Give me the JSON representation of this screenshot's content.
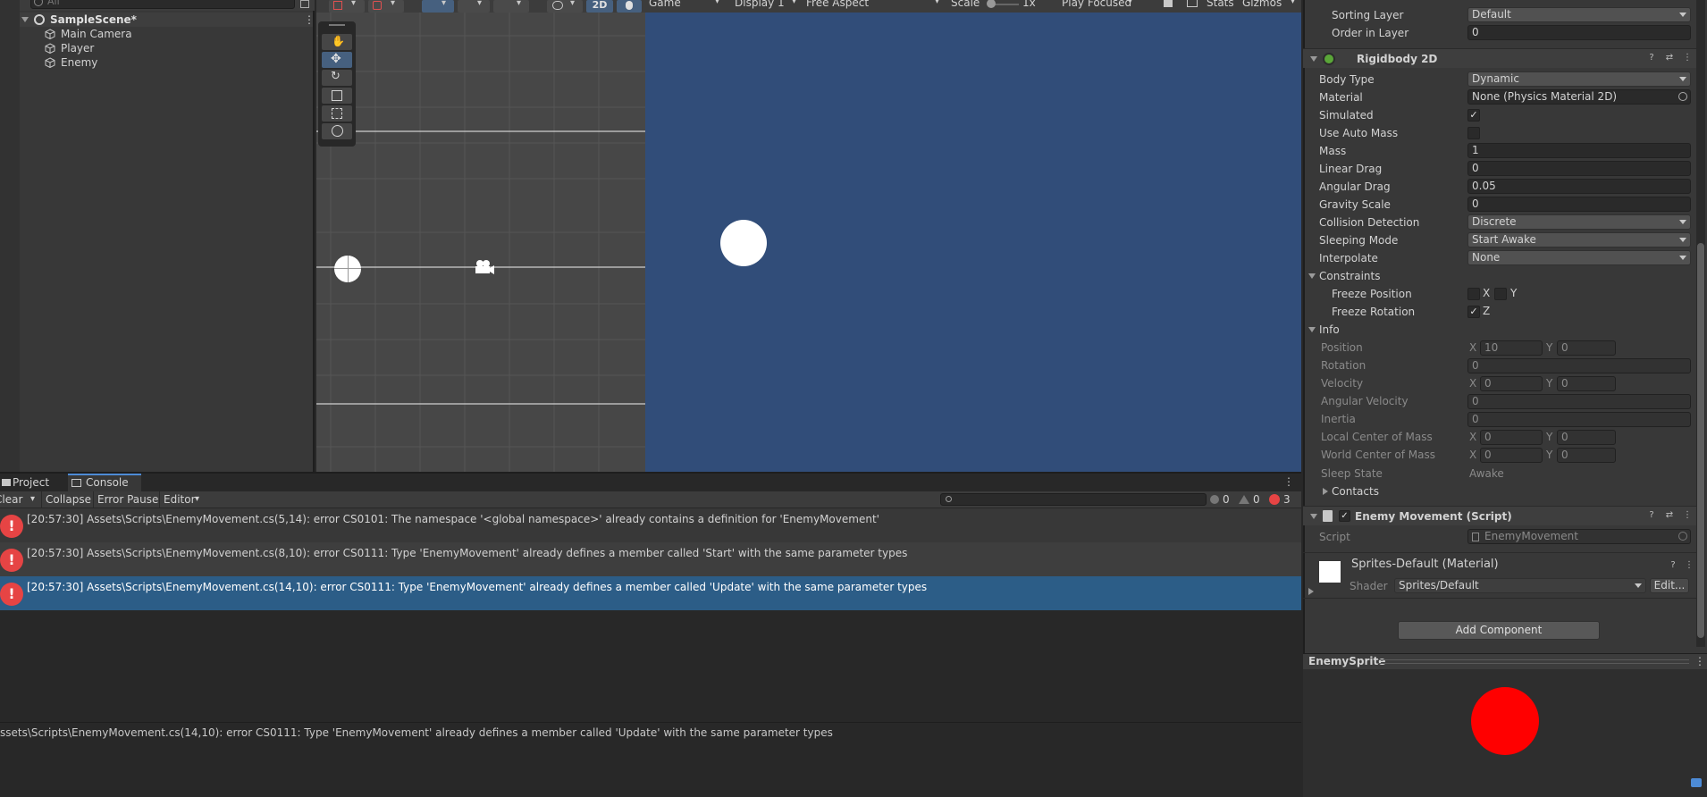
{
  "hierarchy": {
    "search_placeholder": "All",
    "scene_name": "SampleScene*",
    "items": [
      {
        "label": "Main Camera"
      },
      {
        "label": "Player"
      },
      {
        "label": "Enemy"
      }
    ]
  },
  "scene_toolbar": {
    "mode_2d": "2D"
  },
  "game_toolbar": {
    "view": "Game",
    "display": "Display 1",
    "aspect": "Free Aspect",
    "scale_label": "Scale",
    "scale_value": "1x",
    "play_mode": "Play Focused",
    "stats": "Stats",
    "gizmos": "Gizmos"
  },
  "console": {
    "tabs": [
      {
        "label": "Project"
      },
      {
        "label": "Console"
      }
    ],
    "toolbar": {
      "clear": "Clear",
      "collapse": "Collapse",
      "error_pause": "Error Pause",
      "editor": "Editor",
      "log_count": "0",
      "warn_count": "0",
      "error_count": "3"
    },
    "messages": [
      {
        "text": "[20:57:30] Assets\\Scripts\\EnemyMovement.cs(5,14): error CS0101: The namespace '<global namespace>' already contains a definition for 'EnemyMovement'"
      },
      {
        "text": "[20:57:30] Assets\\Scripts\\EnemyMovement.cs(8,10): error CS0111: Type 'EnemyMovement' already defines a member called 'Start' with the same parameter types"
      },
      {
        "text": "[20:57:30] Assets\\Scripts\\EnemyMovement.cs(14,10): error CS0111: Type 'EnemyMovement' already defines a member called 'Update' with the same parameter types"
      }
    ],
    "detail": "ssets\\Scripts\\EnemyMovement.cs(14,10): error CS0111: Type 'EnemyMovement' already defines a member called 'Update' with the same parameter types"
  },
  "inspector": {
    "sprite_renderer": {
      "sorting_layer_label": "Sorting Layer",
      "sorting_layer_value": "Default",
      "order_label": "Order in Layer",
      "order_value": "0"
    },
    "rigidbody": {
      "title": "Rigidbody 2D",
      "body_type_label": "Body Type",
      "body_type_value": "Dynamic",
      "material_label": "Material",
      "material_value": "None (Physics Material 2D)",
      "simulated_label": "Simulated",
      "use_auto_mass_label": "Use Auto Mass",
      "mass_label": "Mass",
      "mass_value": "1",
      "linear_drag_label": "Linear Drag",
      "linear_drag_value": "0",
      "angular_drag_label": "Angular Drag",
      "angular_drag_value": "0.05",
      "gravity_label": "Gravity Scale",
      "gravity_value": "0",
      "collision_label": "Collision Detection",
      "collision_value": "Discrete",
      "sleeping_label": "Sleeping Mode",
      "sleeping_value": "Start Awake",
      "interpolate_label": "Interpolate",
      "interpolate_value": "None",
      "constraints_label": "Constraints",
      "freeze_position_label": "Freeze Position",
      "freeze_rotation_label": "Freeze Rotation",
      "axis_x": "X",
      "axis_y": "Y",
      "axis_z": "Z",
      "info_label": "Info",
      "position_label": "Position",
      "position_x": "10",
      "position_y": "0",
      "rotation_label": "Rotation",
      "rotation_value": "0",
      "velocity_label": "Velocity",
      "velocity_x": "0",
      "velocity_y": "0",
      "angular_velocity_label": "Angular Velocity",
      "angular_velocity_value": "0",
      "inertia_label": "Inertia",
      "inertia_value": "0",
      "local_com_label": "Local Center of Mass",
      "local_com_x": "0",
      "local_com_y": "0",
      "world_com_label": "World Center of Mass",
      "world_com_x": "0",
      "world_com_y": "0",
      "sleep_state_label": "Sleep State",
      "sleep_state_value": "Awake",
      "contacts_label": "Contacts"
    },
    "script_component": {
      "title": "Enemy Movement (Script)",
      "script_label": "Script",
      "script_value": "EnemyMovement"
    },
    "material": {
      "title": "Sprites-Default (Material)",
      "shader_label": "Shader",
      "shader_value": "Sprites/Default",
      "edit_label": "Edit..."
    },
    "add_component": "Add Component",
    "preview_title": "EnemySprite"
  },
  "colors": {
    "game_bg": "#314d79",
    "error": "#e64444",
    "selection": "#2c5d87",
    "enemy_sprite": "#ff0000"
  }
}
